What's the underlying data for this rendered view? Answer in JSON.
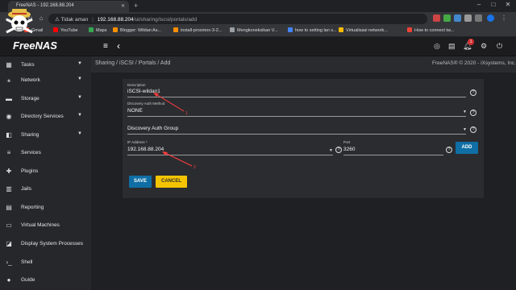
{
  "browser": {
    "tab_title": "FreeNAS - 192.168.88.204",
    "new_tab": "+",
    "window_controls": [
      "–",
      "□",
      "✕"
    ],
    "security_label": "Tidak aman",
    "url_host": "192.168.88.204",
    "url_path": "/ui/sharing/iscsi/portals/add",
    "bookmarks": [
      {
        "label": "Gmail",
        "color": "#ea4335"
      },
      {
        "label": "YouTube",
        "color": "#ff0000"
      },
      {
        "label": "Maps",
        "color": "#34a853"
      },
      {
        "label": "Blogger: Wildan As...",
        "color": "#ff8f00"
      },
      {
        "label": "install-proxmox-3-2...",
        "color": "#ff8f00"
      },
      {
        "label": "Mengkoneksikan V...",
        "color": "#9aa0a6"
      },
      {
        "label": "how to setting lan s...",
        "color": "#4285f4"
      },
      {
        "label": "Virtualisasi network...",
        "color": "#fbbc04"
      },
      {
        "label": "How to connect tw...",
        "color": "#ea4335"
      }
    ]
  },
  "app": {
    "brand": "FreeNAS",
    "hamburger": "≡",
    "back": "‹",
    "notification_count": "1",
    "breadcrumb": "Sharing / iSCSI / Portals / Add",
    "copyright": "FreeNAS® © 2020 - iXsystems, Inc."
  },
  "sidebar": {
    "items": [
      {
        "label": "Tasks",
        "icon": "calendar-icon",
        "glyph": "▦",
        "caret": true
      },
      {
        "label": "Network",
        "icon": "network-icon",
        "glyph": "⚹",
        "caret": true
      },
      {
        "label": "Storage",
        "icon": "storage-icon",
        "glyph": "▬",
        "caret": true
      },
      {
        "label": "Directory Services",
        "icon": "directory-icon",
        "glyph": "◉",
        "caret": true
      },
      {
        "label": "Sharing",
        "icon": "sharing-icon",
        "glyph": "◧",
        "caret": true
      },
      {
        "label": "Services",
        "icon": "services-icon",
        "glyph": "≡",
        "caret": false
      },
      {
        "label": "Plugins",
        "icon": "plugins-icon",
        "glyph": "✚",
        "caret": false
      },
      {
        "label": "Jails",
        "icon": "jails-icon",
        "glyph": "▥",
        "caret": false
      },
      {
        "label": "Reporting",
        "icon": "reporting-icon",
        "glyph": "▤",
        "caret": false
      },
      {
        "label": "Virtual Machines",
        "icon": "vm-icon",
        "glyph": "▭",
        "caret": false
      },
      {
        "label": "Display System Processes",
        "icon": "processes-icon",
        "glyph": "◪",
        "caret": false
      },
      {
        "label": "Shell",
        "icon": "shell-icon",
        "glyph": "›_",
        "caret": false
      },
      {
        "label": "Guide",
        "icon": "guide-icon",
        "glyph": "●",
        "caret": false
      }
    ]
  },
  "form": {
    "description_label": "Description",
    "description_value": "iSCSI-wildan1",
    "auth_method_label": "Discovery Auth Method",
    "auth_method_value": "NONE",
    "auth_group_label": "Discovery Auth Group",
    "ip_label": "IP Address *",
    "ip_value": "192.168.88.204",
    "port_label": "Port",
    "port_value": "3260",
    "help_glyph": "?",
    "add_button": "ADD",
    "save_button": "SAVE",
    "cancel_button": "CANCEL"
  },
  "annotations": {
    "first": "1",
    "second": "2"
  },
  "colors": {
    "accent": "#0f6ea5",
    "cancel": "#f5c400",
    "annotation": "#ff3d3d"
  }
}
